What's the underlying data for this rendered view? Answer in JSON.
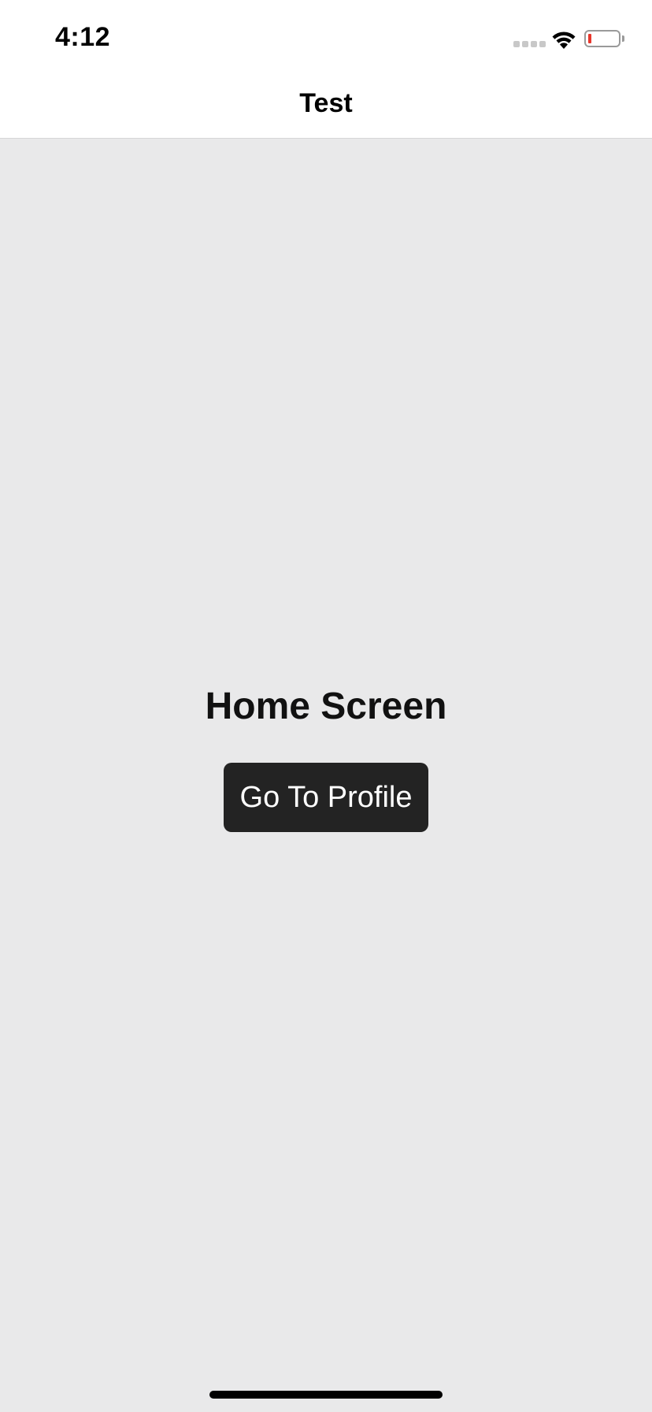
{
  "status_bar": {
    "time": "4:12",
    "battery_color": "#e8372c"
  },
  "nav": {
    "title": "Test"
  },
  "main": {
    "heading": "Home Screen",
    "button_label": "Go To Profile"
  },
  "colors": {
    "background": "#e9e9ea",
    "button": "#232323"
  }
}
